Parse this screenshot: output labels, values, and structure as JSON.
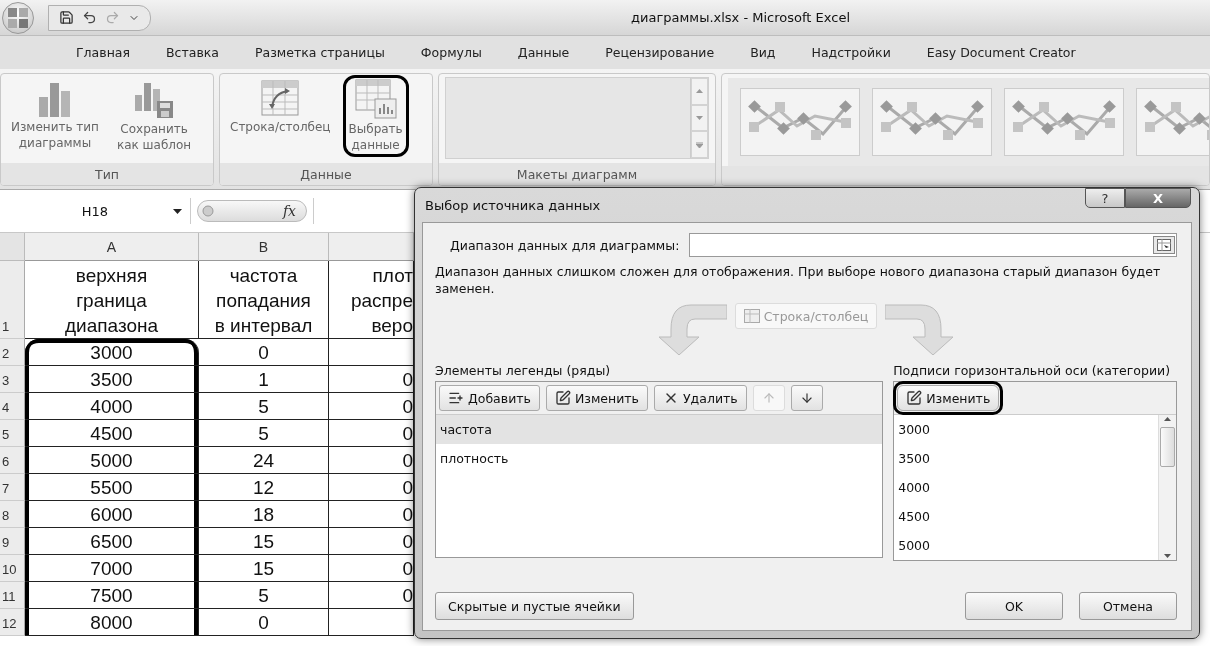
{
  "window": {
    "title": "диаграммы.xlsx - Microsoft Excel"
  },
  "tabs": [
    {
      "label": "Главная",
      "selected": false
    },
    {
      "label": "Вставка",
      "selected": false
    },
    {
      "label": "Разметка страницы",
      "selected": false
    },
    {
      "label": "Формулы",
      "selected": false
    },
    {
      "label": "Данные",
      "selected": false
    },
    {
      "label": "Рецензирование",
      "selected": false
    },
    {
      "label": "Вид",
      "selected": false
    },
    {
      "label": "Надстройки",
      "selected": false
    },
    {
      "label": "Easy Document Creator",
      "selected": false
    }
  ],
  "ribbon": {
    "groups": [
      {
        "kind": "buttons",
        "label": "Тип",
        "buttons": [
          {
            "label": "Изменить тип\nдиаграммы",
            "kind": "change-type",
            "highlighted": false
          },
          {
            "label": "Сохранить\nкак шаблон",
            "kind": "save-template",
            "highlighted": false
          }
        ]
      },
      {
        "kind": "buttons",
        "label": "Данные",
        "buttons": [
          {
            "label": "Строка/столбец",
            "kind": "switch",
            "highlighted": false
          },
          {
            "label": "Выбрать\nданные",
            "kind": "select-data",
            "highlighted": true
          }
        ]
      },
      {
        "kind": "layouts",
        "label": "Макеты диаграмм"
      },
      {
        "kind": "styles"
      }
    ]
  },
  "formula_bar": {
    "name_box": "H18",
    "formula_label": "fx"
  },
  "sheet": {
    "columns": [
      {
        "label": "A",
        "highlighted": true
      },
      {
        "label": "B",
        "highlighted": false
      }
    ],
    "rows": [
      {
        "number": "1",
        "cells": [
          "верхняя\nграница\nдиапазона",
          "частота\nпопадания\nв интервал",
          "плот\nраспре\nверо"
        ]
      },
      {
        "number": "2",
        "cells": [
          "3000",
          "0",
          ""
        ]
      },
      {
        "number": "3",
        "cells": [
          "3500",
          "1",
          "0"
        ]
      },
      {
        "number": "4",
        "cells": [
          "4000",
          "5",
          "0"
        ]
      },
      {
        "number": "5",
        "cells": [
          "4500",
          "5",
          "0"
        ]
      },
      {
        "number": "6",
        "cells": [
          "5000",
          "24",
          "0"
        ]
      },
      {
        "number": "7",
        "cells": [
          "5500",
          "12",
          "0"
        ]
      },
      {
        "number": "8",
        "cells": [
          "6000",
          "18",
          "0"
        ]
      },
      {
        "number": "9",
        "cells": [
          "6500",
          "15",
          "0"
        ]
      },
      {
        "number": "10",
        "cells": [
          "7000",
          "15",
          "0"
        ]
      },
      {
        "number": "11",
        "cells": [
          "7500",
          "5",
          "0"
        ]
      },
      {
        "number": "12",
        "cells": [
          "8000",
          "0",
          ""
        ]
      }
    ]
  },
  "dialog": {
    "title": "Выбор источника данных",
    "help": "?",
    "close": "X",
    "range_label": "Диапазон данных для диаграммы:",
    "message": "Диапазон данных слишком сложен для отображения. При выборе нового диапазона старый диапазон будет заменен.",
    "switch_button": {
      "label": "Строка/столбец",
      "disabled": true
    },
    "legend": {
      "label": "Элементы легенды (ряды)",
      "buttons": [
        {
          "kind": "add",
          "label": "Добавить",
          "disabled": false
        },
        {
          "kind": "edit",
          "label": "Изменить",
          "disabled": false
        },
        {
          "kind": "delete",
          "label": "Удалить",
          "disabled": false
        },
        {
          "kind": "up",
          "disabled": true
        },
        {
          "kind": "down",
          "disabled": false
        }
      ],
      "items": [
        {
          "label": "частота",
          "selected": true
        },
        {
          "label": "плотность",
          "selected": false
        }
      ]
    },
    "axis": {
      "label": "Подписи горизонтальной оси (категории)",
      "edit_button": {
        "label": "Изменить",
        "highlighted": true
      },
      "items": [
        "3000",
        "3500",
        "4000",
        "4500",
        "5000"
      ]
    },
    "footer": {
      "hidden_cells": "Скрытые и пустые ячейки",
      "ok": "OK",
      "cancel": "Отмена"
    }
  }
}
